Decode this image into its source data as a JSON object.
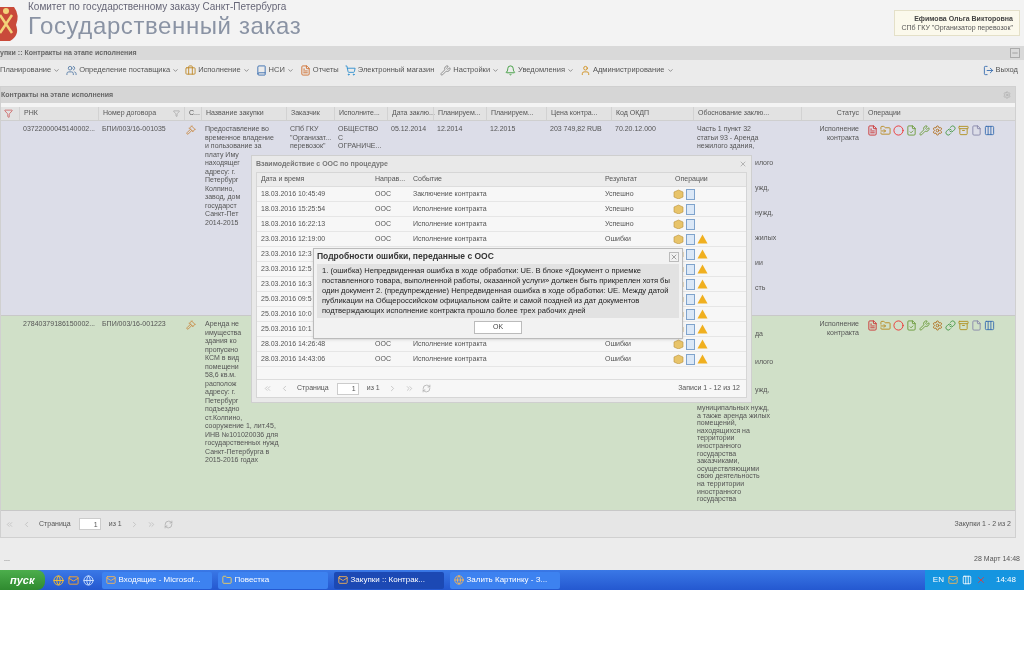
{
  "header": {
    "org": "Комитет по государственному заказу Санкт-Петербурга",
    "title": "Государственный заказ",
    "user_name": "Ефимова Ольга Викторовна",
    "user_org": "СПб ГКУ \"Организатор перевозок\""
  },
  "breadcrumb": "упки :: Контракты на этапе исполнения",
  "menu": [
    {
      "label": "Планирование",
      "dropdown": true
    },
    {
      "label": "Определение поставщика",
      "dropdown": true
    },
    {
      "label": "Исполнение",
      "dropdown": true
    },
    {
      "label": "НСИ",
      "dropdown": true
    },
    {
      "label": "Отчеты",
      "dropdown": false
    },
    {
      "label": "Электронный магазин",
      "dropdown": false
    },
    {
      "label": "Настройки",
      "dropdown": true
    },
    {
      "label": "Уведомления",
      "dropdown": true
    },
    {
      "label": "Администрирование",
      "dropdown": true
    }
  ],
  "logout": "Выход",
  "panel_title": "Контракты на этапе исполнения",
  "table": {
    "columns": [
      "РНК",
      "Номер договора",
      "С...",
      "Название закупки",
      "Заказчик",
      "Исполните...",
      "Дата заклю...",
      "Планируем...",
      "Планируем...",
      "Цена контра...",
      "Код ОКДП",
      "Обоснование заклю...",
      "Статус",
      "Операции"
    ],
    "rows": [
      {
        "color": "#dcdde8",
        "rnk": "03722000045140002...",
        "number": "БПИ/003/16-001035",
        "name_lines": [
          "Предоставление во",
          "временное владение",
          "и пользование за",
          "плату Иму",
          "находящег",
          "адресу: г.",
          "Петербург",
          "Колпино,",
          "завод, дом",
          "государст",
          "Санкт-Пет",
          "2014-2015"
        ],
        "customer_lines": [
          "СПб ГКУ",
          "\"Организат...",
          "перевозок\""
        ],
        "supplier_lines": [
          "ОБЩЕСТВО",
          "С",
          "ОГРАНИЧЕ..."
        ],
        "date": "05.12.2014",
        "plan_start": "12.2014",
        "plan_end": "12.2015",
        "price": "203 749,82 RUB",
        "okdp": "70.20.12.000",
        "basis_lines": [
          "Часть 1 пункт 32",
          "статьи 93 - Аренда",
          "нежилого здания,"
        ],
        "basis_fragments": [
          "илого",
          "ужд,",
          "нужд,",
          "жилых",
          "ии",
          "сть"
        ],
        "basis_tail": [],
        "status_lines": [
          "Исполнение",
          "контракта"
        ]
      },
      {
        "color": "#d0e0c8",
        "rnk": "27840379186150002...",
        "number": "БПИ/003/16-001223",
        "name_lines": [
          "Аренда не",
          "имущества",
          "здания ко",
          "пропускно",
          "КСМ в вид",
          "помещени",
          "58,6 кв.м.",
          "располож",
          "адресу: г.",
          "Петербург",
          "подъездно",
          "ст.Колпино,",
          "сооружение 1, лит.45,",
          "ИНВ №101020036 для",
          "государственных нужд",
          "Санкт-Петербурга в",
          "2015-2016 годах"
        ],
        "basis_lines": [],
        "basis_fragments": [
          "да",
          "илого",
          "ужд,"
        ],
        "basis_tail": [
          "муниципальных нужд,",
          "а также аренда жилых",
          "помещений,",
          "находящихся на",
          "территории",
          "иностранного",
          "государства",
          "заказчиками,",
          "осуществляющими",
          "свою деятельность",
          "на территории",
          "иностранного",
          "государства"
        ],
        "status_lines": [
          "Исполнение",
          "контракта"
        ]
      }
    ]
  },
  "paging": {
    "page_label": "Страница",
    "page": "1",
    "of": "из 1",
    "summary": "Закупки 1 - 2 из 2"
  },
  "status_bar": {
    "left": "...",
    "date": "28 Март 14:48"
  },
  "dialog": {
    "title": "Взаимодействие с ООС по процедуре",
    "columns": [
      "Дата и время",
      "Направ...",
      "Событие",
      "Результат",
      "Операции"
    ],
    "rows": [
      {
        "date": "18.03.2016 10:45:49",
        "dir": "ООС",
        "event": "Заключение контракта",
        "result": "Успешно",
        "warning": false
      },
      {
        "date": "18.03.2016 15:25:54",
        "dir": "ООС",
        "event": "Исполнение контракта",
        "result": "Успешно",
        "warning": false
      },
      {
        "date": "18.03.2016 16:22:13",
        "dir": "ООС",
        "event": "Исполнение контракта",
        "result": "Успешно",
        "warning": false
      },
      {
        "date": "23.03.2016 12:19:00",
        "dir": "ООС",
        "event": "Исполнение контракта",
        "result": "Ошибки",
        "warning": true
      },
      {
        "date": "23.03.2016 12:3",
        "warning": true
      },
      {
        "date": "23.03.2016 12:5",
        "warning": true
      },
      {
        "date": "23.03.2016 16:3",
        "warning": true
      },
      {
        "date": "25.03.2016 09:5",
        "warning": true
      },
      {
        "date": "25.03.2016 10:0",
        "warning": true
      },
      {
        "date": "25.03.2016 10:1",
        "warning": true
      },
      {
        "date": "28.03.2016 14:26:48",
        "dir": "ООС",
        "event": "Исполнение контракта",
        "result": "Ошибки",
        "warning": true
      },
      {
        "date": "28.03.2016 14:43:06",
        "dir": "ООС",
        "event": "Исполнение контракта",
        "result": "Ошибки",
        "warning": true
      }
    ],
    "paging": {
      "page_label": "Страница",
      "page": "1",
      "of": "из 1",
      "summary": "Записи 1 - 12 из 12"
    }
  },
  "error_dialog": {
    "title": "Подробности ошибки, переданные с ООС",
    "message": "1. (ошибка) Непредвиденная ошибка в ходе обработки: UE. В блоке «Документ о приемке поставленного товара, выполненной работы, оказанной услуги» должен быть прикреплен хотя бы один документ 2. (предупреждение) Непредвиденная ошибка в ходе обработки: UE. Между датой публикации на Общероссийском официальном сайте и самой поздней из дат документов подтверждающих исполнение контракта прошло более трех рабочих дней",
    "ok": "OK"
  },
  "taskbar": {
    "start": "пуск",
    "tasks": [
      {
        "label": "Входящие - Microsof...",
        "selected": false
      },
      {
        "label": "Повестка",
        "selected": false
      },
      {
        "label": "Закупки :: Контрак...",
        "selected": true
      },
      {
        "label": "Залить Картинку - З...",
        "selected": false
      }
    ],
    "lang": "EN",
    "clock": "14:48"
  }
}
